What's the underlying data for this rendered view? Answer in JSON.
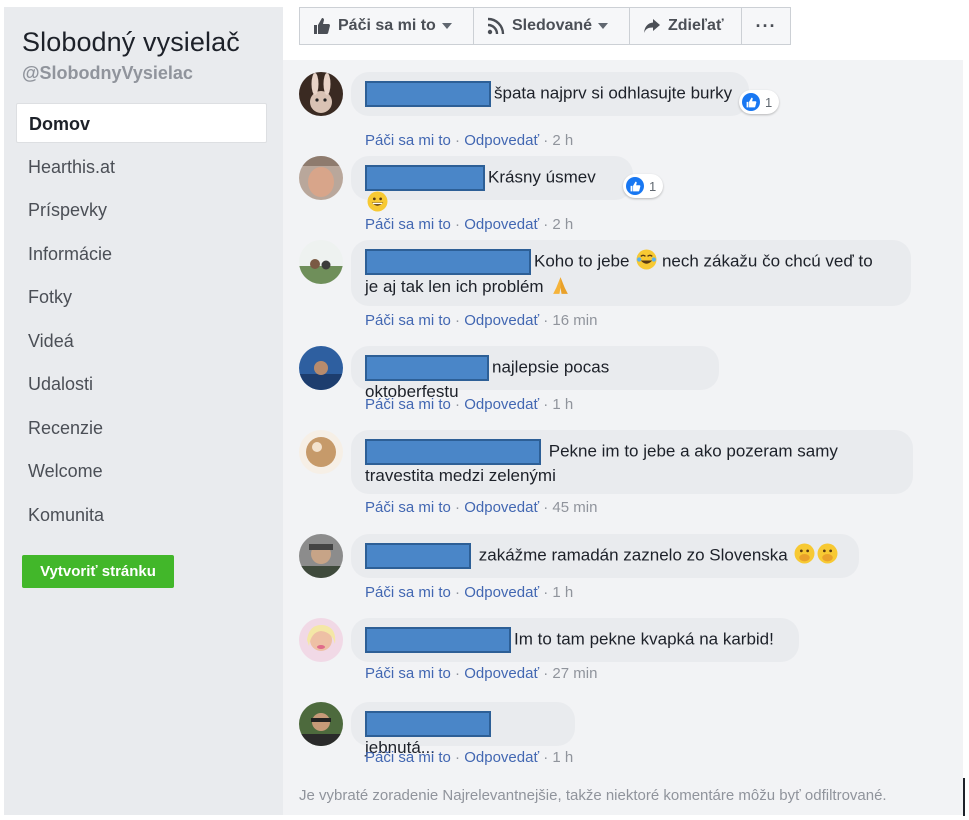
{
  "sidebar": {
    "page_name": "Slobodný vysielač",
    "handle": "@SlobodnyVysielac",
    "nav": [
      {
        "label": "Domov",
        "active": true
      },
      {
        "label": "Hearthis.at",
        "active": false
      },
      {
        "label": "Príspevky",
        "active": false
      },
      {
        "label": "Informácie",
        "active": false
      },
      {
        "label": "Fotky",
        "active": false
      },
      {
        "label": "Videá",
        "active": false
      },
      {
        "label": "Udalosti",
        "active": false
      },
      {
        "label": "Recenzie",
        "active": false
      },
      {
        "label": "Welcome",
        "active": false
      },
      {
        "label": "Komunita",
        "active": false
      }
    ],
    "create_button": "Vytvoriť stránku"
  },
  "actionbar": {
    "like": "Páči sa mi to",
    "follow": "Sledované",
    "share": "Zdieľať",
    "more": "···"
  },
  "comments": [
    {
      "text": "špata najprv si odhlasujte burky",
      "time": "2 h",
      "reactions": "1"
    },
    {
      "text": "Krásny úsmev",
      "time": "2 h",
      "reactions": "1"
    },
    {
      "text": "Koho to jebe",
      "text_b": "nech zákažu čo chcú veď to",
      "text_c": "je aj tak len ich problém",
      "time": "16 min"
    },
    {
      "text": "najlepsie pocas oktoberfestu",
      "time": "1 h"
    },
    {
      "text": "Pekne im to jebe a ako pozeram samy",
      "text_b": "travestita medzi zelenými",
      "time": "45 min"
    },
    {
      "text": "zakážme ramadán zaznelo zo Slovenska",
      "time": "1 h"
    },
    {
      "text": "Im to tam pekne kvapká na karbid!",
      "time": "27 min"
    },
    {
      "text": "jebnutá...",
      "time": "1 h"
    }
  ],
  "meta": {
    "like": "Páči sa mi to",
    "sep": " · ",
    "reply": "Odpovedať"
  },
  "footer": "Je vybraté zoradenie Najrelevantnejšie, takže niektoré komentáre môžu byť odfiltrované.",
  "colors": {
    "link": "#4267b2",
    "create_button": "#42b72a",
    "redaction": "#4a86c8",
    "like_reaction": "#1877f2"
  }
}
